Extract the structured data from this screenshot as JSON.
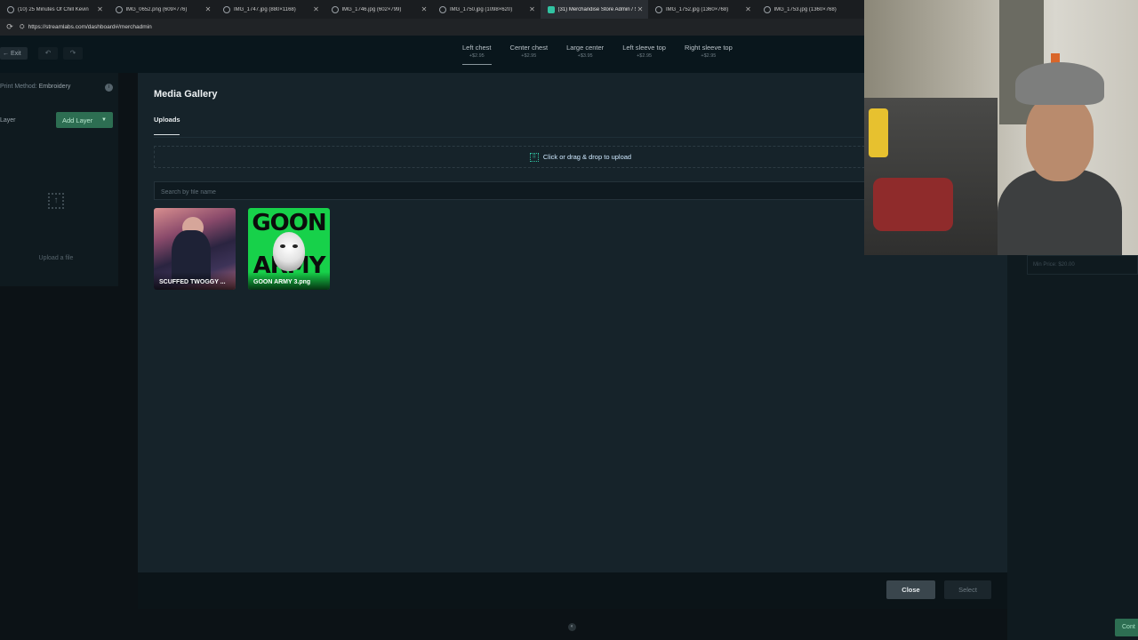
{
  "browser": {
    "tabs": [
      {
        "title": "(10) 25 Minutes Of Chill Kevin",
        "active": false
      },
      {
        "title": "IMG_0652.png (609×776)",
        "active": false
      },
      {
        "title": "IMG_1747.jpg (880×1168)",
        "active": false
      },
      {
        "title": "IMG_1746.jpg (602×799)",
        "active": false
      },
      {
        "title": "IMG_1750.jpg (1098×620)",
        "active": false
      },
      {
        "title": "(31) Merchandise Store Admin / S",
        "active": true
      },
      {
        "title": "IMG_1752.jpg (1360×768)",
        "active": false
      },
      {
        "title": "IMG_1753.jpg (1360×768)",
        "active": false
      }
    ],
    "url": "https://streamlabs.com/dashboard#/merchadmin"
  },
  "topnav": {
    "exit_label": "Exit",
    "undo_icon": "undo-icon",
    "redo_icon": "redo-icon",
    "placements": [
      {
        "name": "Left chest",
        "price": "+$2.95",
        "active": true
      },
      {
        "name": "Center chest",
        "price": "+$2.95",
        "active": false
      },
      {
        "name": "Large center",
        "price": "+$3.95",
        "active": false
      },
      {
        "name": "Left sleeve top",
        "price": "+$2.95",
        "active": false
      },
      {
        "name": "Right sleeve top",
        "price": "+$2.95",
        "active": false
      }
    ]
  },
  "left_panel": {
    "print_method_label": "Print Method:",
    "print_method_value": "Embroidery",
    "layer_label": "Layer",
    "add_layer_label": "Add Layer",
    "upload_label": "Upload a file"
  },
  "modal": {
    "title": "Media Gallery",
    "tab": "Uploads",
    "drop_label": "Click or drag & drop to upload",
    "search_placeholder": "Search by file name",
    "files": [
      {
        "name": "SCUFFED TWOGGY ..."
      },
      {
        "name": "GOON ARMY 3.png"
      }
    ],
    "close_label": "Close",
    "select_label": "Select"
  },
  "right_panel": {
    "min_price": "Min Price: $20.00",
    "continue_label": "Cont"
  },
  "colors": {
    "accent_green": "#2d6e52",
    "teal": "#31c3a2",
    "modal_bg": "#16232a"
  }
}
